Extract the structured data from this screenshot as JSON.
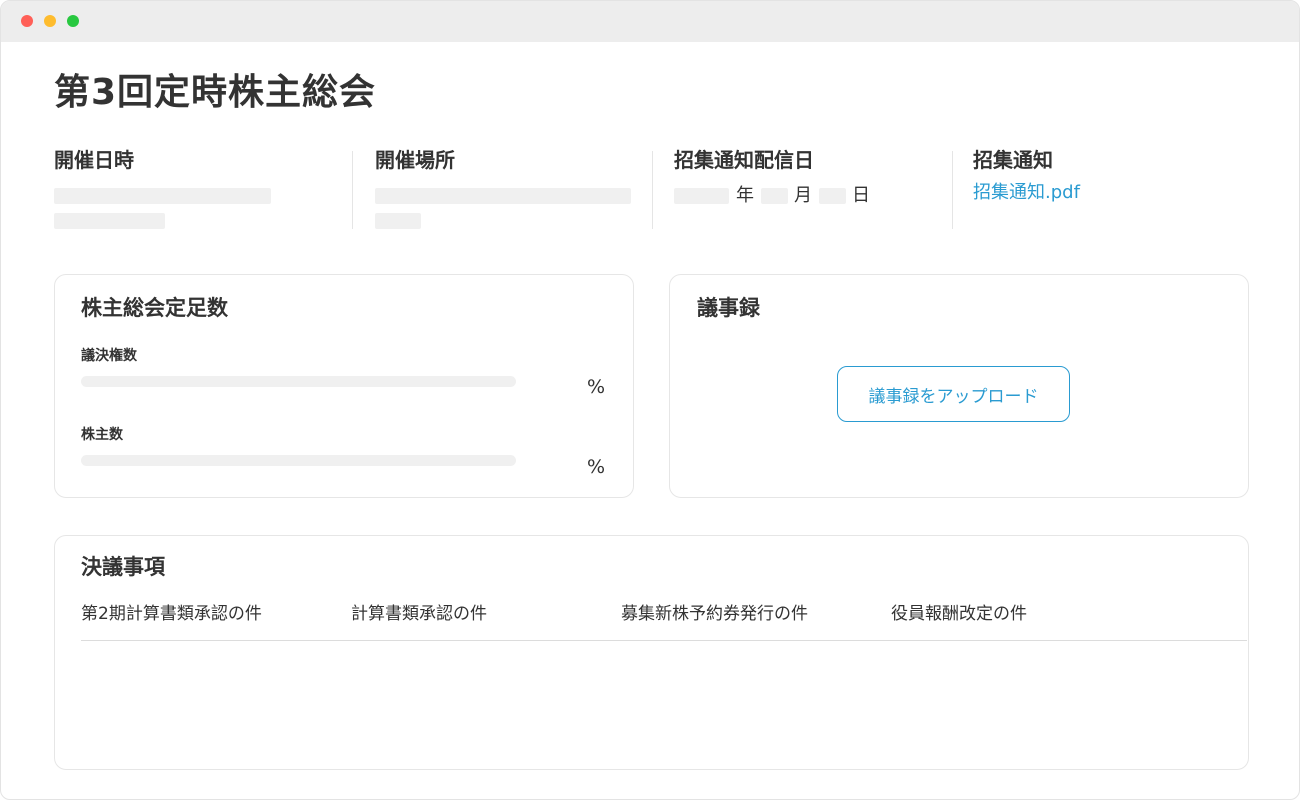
{
  "page": {
    "title": "第3回定時株主総会"
  },
  "info": {
    "datetime_label": "開催日時",
    "venue_label": "開催場所",
    "notice_date_label": "招集通知配信日",
    "notice_date": {
      "year_unit": "年",
      "month_unit": "月",
      "day_unit": "日"
    },
    "notice_label": "招集通知",
    "notice_file": "招集通知.pdf"
  },
  "quorum": {
    "title": "株主総会定足数",
    "voting_rights_label": "議決権数",
    "voting_rights_unit": "%",
    "shareholders_label": "株主数",
    "shareholders_unit": "%"
  },
  "minutes": {
    "title": "議事録",
    "upload_label": "議事録をアップロード"
  },
  "resolutions": {
    "title": "決議事項",
    "items": [
      "第2期計算書類承認の件",
      "計算書類承認の件",
      "募集新株予約券発行の件",
      "役員報酬改定の件"
    ]
  },
  "colors": {
    "accent": "#2a9bd1",
    "titlebar": "#ededed",
    "placeholder": "#f0f0f0",
    "close": "#ff5f57",
    "minimize": "#febc2e",
    "maximize": "#28c840"
  }
}
